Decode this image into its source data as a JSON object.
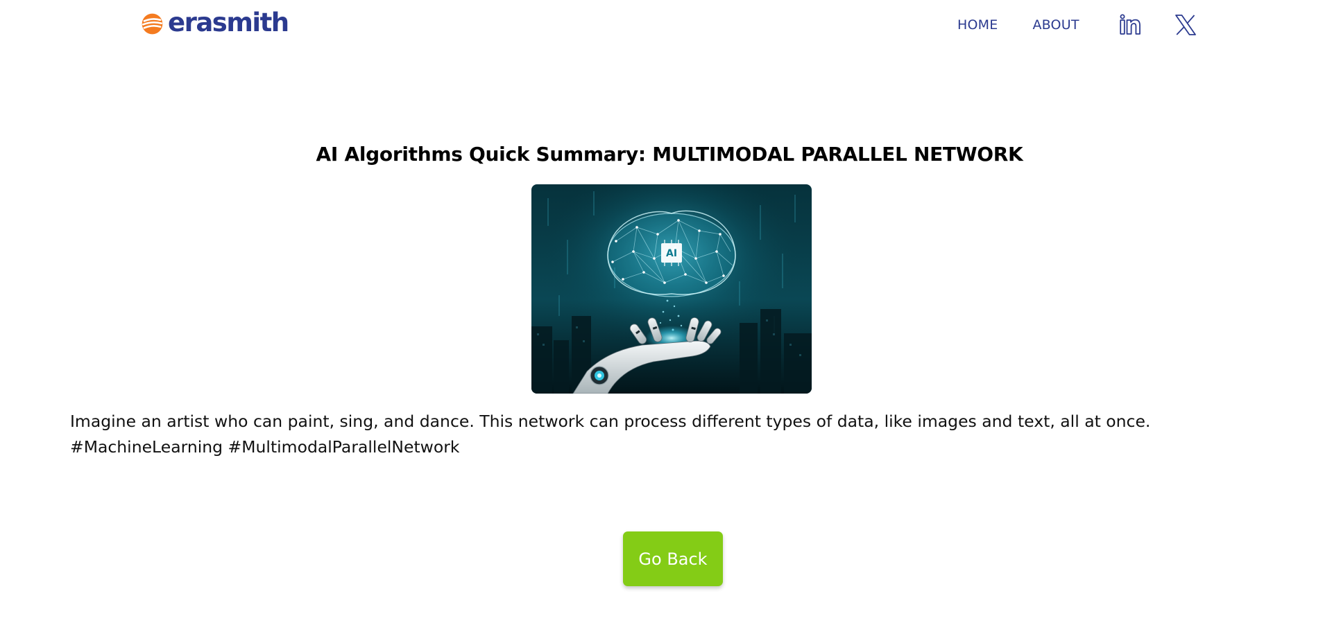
{
  "brand": {
    "name": "erasmith",
    "accent": "#f47b20",
    "primary": "#2b3a8f"
  },
  "nav": {
    "links": [
      {
        "label": "HOME"
      },
      {
        "label": "ABOUT"
      }
    ],
    "social": [
      {
        "icon": "linkedin-icon"
      },
      {
        "icon": "x-twitter-icon"
      }
    ]
  },
  "article": {
    "title": "AI Algorithms Quick Summary: MULTIMODAL PARALLEL NETWORK",
    "image": {
      "icon": "ai-brain-robot-hand-illustration",
      "badge_text": "AI"
    },
    "description_line1": "Imagine an artist who can paint, sing, and dance. This network can process different types of data, like images and text, all at once.",
    "description_line2": "#MachineLearning #MultimodalParallelNetwork"
  },
  "actions": {
    "back_label": "Go Back",
    "back_color": "#84cc16"
  }
}
